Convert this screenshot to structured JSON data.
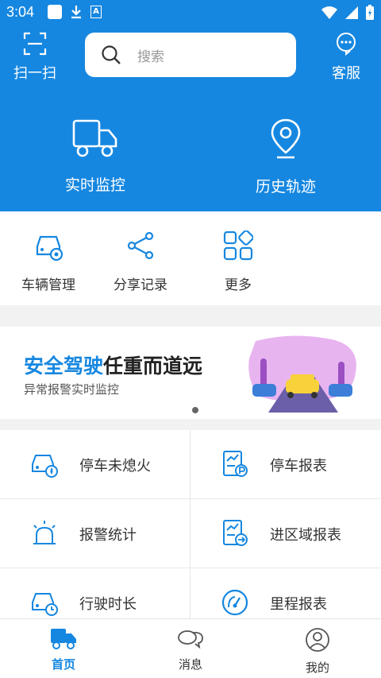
{
  "status_bar": {
    "time": "3:04",
    "input_indicator": "A"
  },
  "header": {
    "scan_label": "扫一扫",
    "search_placeholder": "搜索",
    "service_label": "客服",
    "actions": [
      {
        "label": "实时监控",
        "icon": "truck-icon"
      },
      {
        "label": "历史轨迹",
        "icon": "location-pin-icon"
      }
    ]
  },
  "quick": [
    {
      "label": "车辆管理",
      "icon": "car-settings-icon"
    },
    {
      "label": "分享记录",
      "icon": "share-icon"
    },
    {
      "label": "更多",
      "icon": "grid-more-icon"
    }
  ],
  "banner": {
    "title_highlight": "安全驾驶",
    "title_rest": "任重而道远",
    "subtitle": "异常报警实时监控"
  },
  "features": [
    {
      "label": "停车未熄火",
      "icon": "car-fire-icon"
    },
    {
      "label": "停车报表",
      "icon": "parking-report-icon"
    },
    {
      "label": "报警统计",
      "icon": "alarm-icon"
    },
    {
      "label": "进区域报表",
      "icon": "area-report-icon"
    },
    {
      "label": "行驶时长",
      "icon": "car-clock-icon"
    },
    {
      "label": "里程报表",
      "icon": "speedometer-icon"
    }
  ],
  "tabs": [
    {
      "label": "首页",
      "icon": "truck-icon",
      "active": true
    },
    {
      "label": "消息",
      "icon": "chat-icon",
      "active": false
    },
    {
      "label": "我的",
      "icon": "user-icon",
      "active": false
    }
  ],
  "colors": {
    "primary": "#1687e0"
  }
}
